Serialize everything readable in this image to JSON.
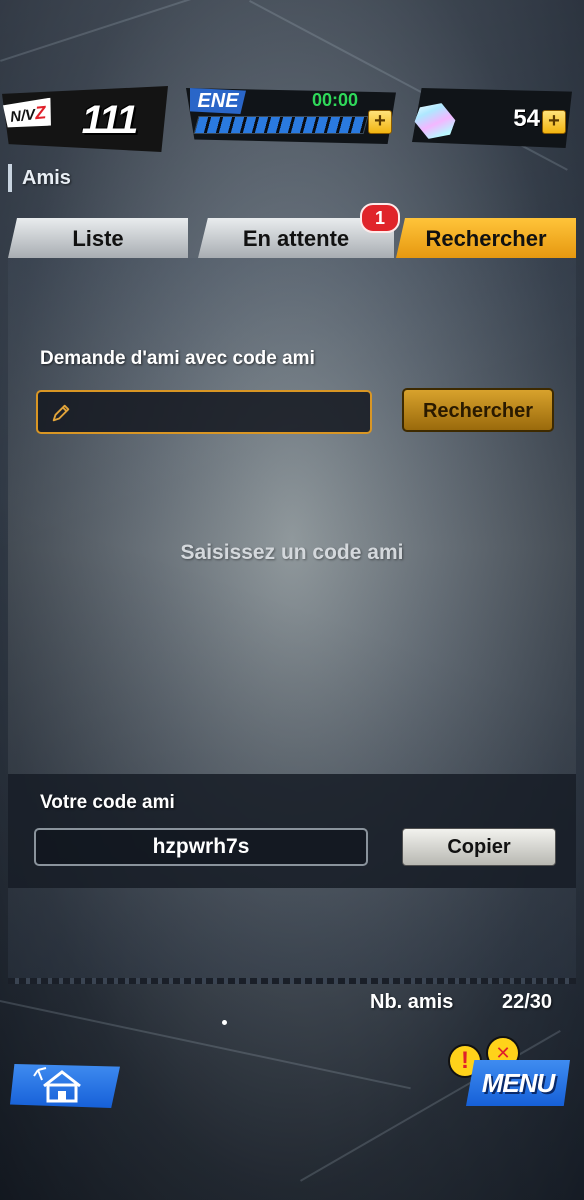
{
  "hud": {
    "level_tag": "N/V",
    "level_tag_suffix": "Z",
    "level_value": "111",
    "ene_label": "ENE",
    "ene_timer": "00:00",
    "ene_fill_fraction": 1.0,
    "gem_count": "54",
    "plus": "+"
  },
  "screen": {
    "title": "Amis"
  },
  "tabs": [
    {
      "label": "Liste",
      "active": false
    },
    {
      "label": "En attente",
      "active": false,
      "badge": "1"
    },
    {
      "label": "Rechercher",
      "active": true
    }
  ],
  "search": {
    "heading": "Demande d'ami avec code ami",
    "input_value": "",
    "button_label": "Rechercher",
    "empty_message": "Saisissez un code ami"
  },
  "my_code": {
    "heading": "Votre code ami",
    "code": "hzpwrh7s",
    "copy_label": "Copier"
  },
  "friends": {
    "label": "Nb. amis",
    "count": "22/30"
  },
  "bottom": {
    "menu_label": "MENU",
    "alert_1": "!",
    "alert_2": "✕"
  },
  "colors": {
    "accent_gold": "#e69810",
    "tab_inactive": "#c9cdd1",
    "ene_blue": "#2a7ae0",
    "timer_green": "#2fd85a",
    "badge_red": "#e0242a",
    "menu_blue": "#1660d8"
  },
  "icons": {
    "input_icon": "pencil-icon",
    "home": "home-icon",
    "gem": "gem-icon"
  }
}
